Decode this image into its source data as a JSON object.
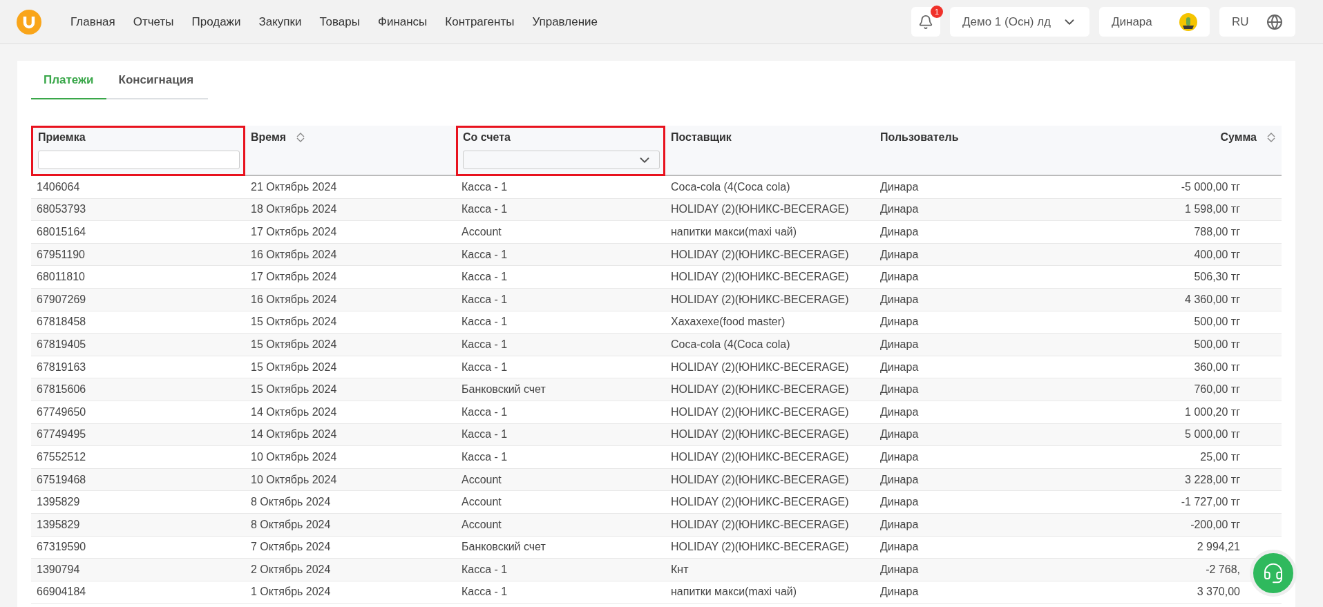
{
  "nav": {
    "items": [
      "Главная",
      "Отчеты",
      "Продажи",
      "Закупки",
      "Товары",
      "Финансы",
      "Контрагенты",
      "Управление"
    ]
  },
  "header": {
    "notifications": "1",
    "company": "Демо 1 (Осн) лд",
    "user": "Динара",
    "language": "RU"
  },
  "tabs": [
    {
      "label": "Платежи",
      "selected": true
    },
    {
      "label": "Консигнация",
      "selected": false
    }
  ],
  "table": {
    "columns": [
      {
        "label": "Приемка",
        "sortable": false,
        "kind": "input",
        "highlighted": true
      },
      {
        "label": "Время",
        "sortable": true,
        "kind": "plain",
        "highlighted": false
      },
      {
        "label": "Со счета",
        "sortable": false,
        "kind": "select",
        "highlighted": true
      },
      {
        "label": "Поставщик",
        "sortable": false,
        "kind": "plain",
        "highlighted": false
      },
      {
        "label": "Пользователь",
        "sortable": false,
        "kind": "plain",
        "highlighted": false
      },
      {
        "label": "Сумма",
        "sortable": true,
        "kind": "amount",
        "highlighted": false
      }
    ],
    "rows": [
      [
        "1406064",
        "21 Октябрь 2024",
        "Касса - 1",
        "Coca-cola (4(Coca cola)",
        "Динара",
        "-5 000,00 тг"
      ],
      [
        "68053793",
        "18 Октябрь 2024",
        "Касса - 1",
        "HOLIDAY (2)(ЮНИКС-BECERAGE)",
        "Динара",
        "1 598,00 тг"
      ],
      [
        "68015164",
        "17 Октябрь 2024",
        "Account",
        "напитки макси(maxi чай)",
        "Динара",
        "788,00 тг"
      ],
      [
        "67951190",
        "16 Октябрь 2024",
        "Касса - 1",
        "HOLIDAY (2)(ЮНИКС-BECERAGE)",
        "Динара",
        "400,00 тг"
      ],
      [
        "68011810",
        "17 Октябрь 2024",
        "Касса - 1",
        "HOLIDAY (2)(ЮНИКС-BECERAGE)",
        "Динара",
        "506,30 тг"
      ],
      [
        "67907269",
        "16 Октябрь 2024",
        "Касса - 1",
        "HOLIDAY (2)(ЮНИКС-BECERAGE)",
        "Динара",
        "4 360,00 тг"
      ],
      [
        "67818458",
        "15 Октябрь 2024",
        "Касса - 1",
        "Xaxaxexe(food master)",
        "Динара",
        "500,00 тг"
      ],
      [
        "67819405",
        "15 Октябрь 2024",
        "Касса - 1",
        "Coca-cola (4(Coca cola)",
        "Динара",
        "500,00 тг"
      ],
      [
        "67819163",
        "15 Октябрь 2024",
        "Касса - 1",
        "HOLIDAY (2)(ЮНИКС-BECERAGE)",
        "Динара",
        "360,00 тг"
      ],
      [
        "67815606",
        "15 Октябрь 2024",
        "Банковский счет",
        "HOLIDAY (2)(ЮНИКС-BECERAGE)",
        "Динара",
        "760,00 тг"
      ],
      [
        "67749650",
        "14 Октябрь 2024",
        "Касса - 1",
        "HOLIDAY (2)(ЮНИКС-BECERAGE)",
        "Динара",
        "1 000,20 тг"
      ],
      [
        "67749495",
        "14 Октябрь 2024",
        "Касса - 1",
        "HOLIDAY (2)(ЮНИКС-BECERAGE)",
        "Динара",
        "5 000,00 тг"
      ],
      [
        "67552512",
        "10 Октябрь 2024",
        "Касса - 1",
        "HOLIDAY (2)(ЮНИКС-BECERAGE)",
        "Динара",
        "25,00 тг"
      ],
      [
        "67519468",
        "10 Октябрь 2024",
        "Account",
        "HOLIDAY (2)(ЮНИКС-BECERAGE)",
        "Динара",
        "3 228,00 тг"
      ],
      [
        "1395829",
        "8 Октябрь 2024",
        "Account",
        "HOLIDAY (2)(ЮНИКС-BECERAGE)",
        "Динара",
        "-1 727,00 тг"
      ],
      [
        "1395829",
        "8 Октябрь 2024",
        "Account",
        "HOLIDAY (2)(ЮНИКС-BECERAGE)",
        "Динара",
        "-200,00 тг"
      ],
      [
        "67319590",
        "7 Октябрь 2024",
        "Банковский счет",
        "HOLIDAY (2)(ЮНИКС-BECERAGE)",
        "Динара",
        "2 994,21"
      ],
      [
        "1390794",
        "2 Октябрь 2024",
        "Касса - 1",
        "Кнт",
        "Динара",
        "-2 768,"
      ],
      [
        "66904184",
        "1 Октябрь 2024",
        "Касса - 1",
        "напитки макси(maxi чай)",
        "Динара",
        "3 370,00"
      ]
    ]
  }
}
